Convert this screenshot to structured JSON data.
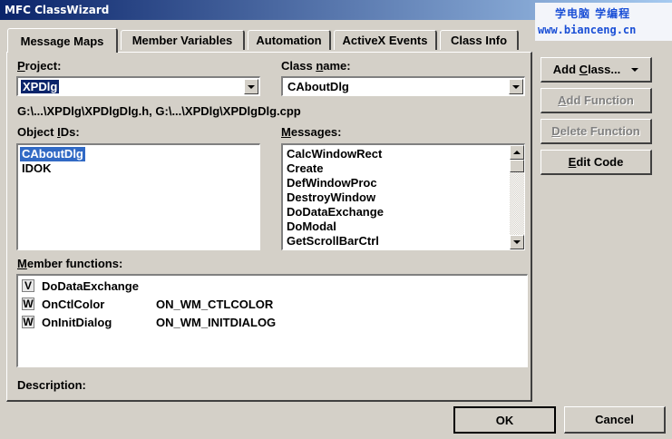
{
  "window": {
    "title": "MFC ClassWizard"
  },
  "watermark": {
    "chinese": "学电脑 学编程",
    "url": "www.bianceng.cn"
  },
  "tabs": [
    {
      "label": "Message Maps",
      "active": true
    },
    {
      "label": "Member Variables",
      "active": false
    },
    {
      "label": "Automation",
      "active": false
    },
    {
      "label": "ActiveX Events",
      "active": false
    },
    {
      "label": "Class Info",
      "active": false
    }
  ],
  "project": {
    "label_pre": "",
    "label_u": "P",
    "label_post": "roject:",
    "value": "XPDlg"
  },
  "classname": {
    "label_pre": "Class ",
    "label_u": "n",
    "label_post": "ame:",
    "value": "CAboutDlg"
  },
  "files": "G:\\...\\XPDlg\\XPDlgDlg.h, G:\\...\\XPDlg\\XPDlgDlg.cpp",
  "object_ids": {
    "label_pre": "Object ",
    "label_u": "I",
    "label_post": "Ds:",
    "items": [
      "CAboutDlg",
      "IDOK"
    ],
    "selected": 0
  },
  "messages": {
    "label_pre": "",
    "label_u": "M",
    "label_post": "essages:",
    "items": [
      "CalcWindowRect",
      "Create",
      "DefWindowProc",
      "DestroyWindow",
      "DoDataExchange",
      "DoModal",
      "GetScrollBarCtrl"
    ]
  },
  "member_functions": {
    "label_pre": "",
    "label_u": "M",
    "label_post": "ember functions:",
    "items": [
      {
        "badge": "V",
        "name": "DoDataExchange",
        "map": ""
      },
      {
        "badge": "W",
        "name": "OnCtlColor",
        "map": "ON_WM_CTLCOLOR"
      },
      {
        "badge": "W",
        "name": "OnInitDialog",
        "map": "ON_WM_INITDIALOG"
      }
    ]
  },
  "description": {
    "label": "Description:"
  },
  "buttons": {
    "add_class": {
      "pre": "Add ",
      "u": "C",
      "post": "lass..."
    },
    "add_function": {
      "pre": "",
      "u": "A",
      "post": "dd Function"
    },
    "delete_function": {
      "pre": "",
      "u": "D",
      "post": "elete Function"
    },
    "edit_code": {
      "pre": "",
      "u": "E",
      "post": "dit Code"
    },
    "ok": "OK",
    "cancel": "Cancel"
  }
}
